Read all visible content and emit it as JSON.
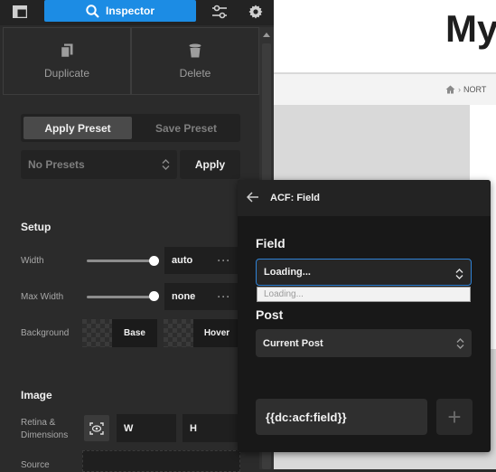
{
  "toolbar": {
    "inspector_label": "Inspector"
  },
  "actions": {
    "duplicate_label": "Duplicate",
    "delete_label": "Delete"
  },
  "presets": {
    "apply_tab": "Apply Preset",
    "save_tab": "Save Preset",
    "select_value": "No Presets",
    "apply_button": "Apply"
  },
  "setup": {
    "title": "Setup",
    "width_label": "Width",
    "width_value": "auto",
    "width_slider": 1.0,
    "max_width_label": "Max Width",
    "max_width_value": "none",
    "max_width_slider": 1.0,
    "background_label": "Background",
    "base_label": "Base",
    "hover_label": "Hover"
  },
  "image": {
    "title": "Image",
    "retina_label": "Retina & Dimensions",
    "w_label": "W",
    "h_label": "H",
    "source_label": "Source"
  },
  "preview": {
    "title": "My",
    "breadcrumb": "NORT"
  },
  "popup": {
    "title": "ACF: Field",
    "field_label": "Field",
    "field_value": "Loading...",
    "field_option": "Loading...",
    "post_label": "Post",
    "post_value": "Current Post",
    "tag_value": "{{dc:acf:field}}",
    "add_symbol": "+"
  },
  "colors": {
    "accent": "#1c8ce4",
    "focus_border": "#2f82d6",
    "panel_bg": "#2b2b2b",
    "popup_bg": "#181818"
  },
  "icons": [
    "layout-icon",
    "search-icon",
    "sliders-icon",
    "gear-icon",
    "duplicate-icon",
    "trash-icon",
    "chevron-updown-icon",
    "ellipsis-icon",
    "back-arrow-icon",
    "home-icon",
    "retina-icon",
    "plus-icon"
  ]
}
